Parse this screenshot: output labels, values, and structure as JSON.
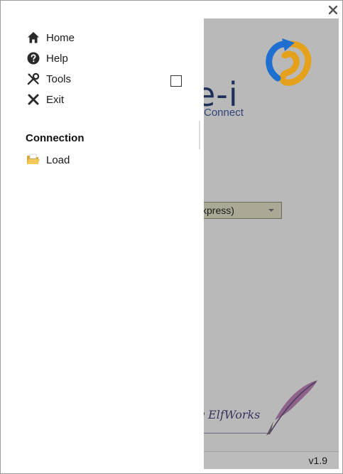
{
  "menu": {
    "items": [
      {
        "label": "Home",
        "icon": "home-icon"
      },
      {
        "label": "Help",
        "icon": "help-icon"
      },
      {
        "label": "Tools",
        "icon": "tools-icon"
      },
      {
        "label": "Exit",
        "icon": "close-icon"
      }
    ],
    "connection": {
      "title": "Connection",
      "items": [
        {
          "label": "Load",
          "icon": "folder-icon"
        }
      ]
    }
  },
  "background": {
    "logo_text": "e-i",
    "logo_sub": "Connect",
    "dropdown_value": "xpress)",
    "credit": "y ElfWorks",
    "version": "v1.9"
  },
  "colors": {
    "overlay": "#b9b9b9",
    "logo_dark": "#1e2f5a",
    "logo_blue": "#1e88e5",
    "logo_orange": "#f4a020"
  }
}
